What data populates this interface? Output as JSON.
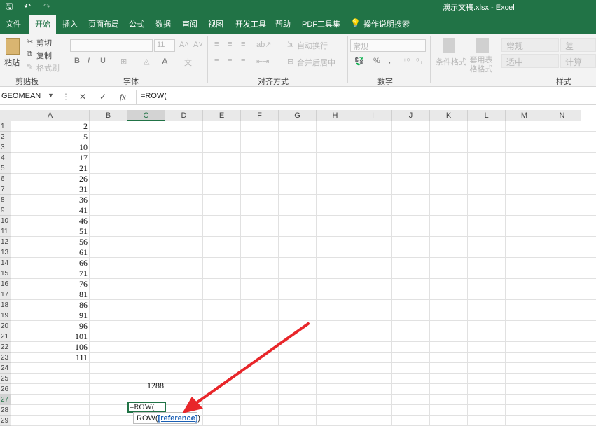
{
  "titlebar": {
    "title": "演示文稿.xlsx - Excel",
    "save_glyph": "🖫",
    "undo_glyph": "↶",
    "redo_glyph": "↷"
  },
  "tabs": [
    "文件",
    "开始",
    "插入",
    "页面布局",
    "公式",
    "数据",
    "审阅",
    "视图",
    "开发工具",
    "帮助",
    "PDF工具集",
    "操作说明搜索"
  ],
  "ribbon": {
    "clipboard": {
      "paste": "粘贴",
      "cut": "剪切",
      "copy": "复制",
      "format_painter": "格式刷",
      "label": "剪贴板"
    },
    "font": {
      "size": "11",
      "bold": "B",
      "italic": "I",
      "underline": "U",
      "label": "字体"
    },
    "alignment": {
      "wrap": "自动换行",
      "merge": "合并后居中",
      "label": "对齐方式"
    },
    "number": {
      "format": "常规",
      "percent": "%",
      "comma": ",",
      "label": "数字"
    },
    "styles": {
      "conditional": "条件格式",
      "table": "套用表格格式",
      "normal": "常规",
      "bad": "差",
      "neutral": "适中",
      "calc": "计算",
      "label": "样式"
    }
  },
  "formula_bar": {
    "name_box": "GEOMEAN",
    "cancel": "✕",
    "enter": "✓",
    "fx": "fx",
    "content": "=ROW("
  },
  "columns": [
    "A",
    "B",
    "C",
    "D",
    "E",
    "F",
    "G",
    "H",
    "I",
    "J",
    "K",
    "L",
    "M",
    "N"
  ],
  "rows": [
    "1",
    "2",
    "3",
    "4",
    "5",
    "6",
    "7",
    "8",
    "9",
    "10",
    "11",
    "12",
    "13",
    "14",
    "15",
    "16",
    "17",
    "18",
    "19",
    "20",
    "21",
    "22",
    "23",
    "24",
    "25",
    "26",
    "27",
    "28",
    "29"
  ],
  "column_a_values": [
    "2",
    "5",
    "10",
    "17",
    "21",
    "26",
    "31",
    "36",
    "41",
    "46",
    "51",
    "56",
    "61",
    "66",
    "71",
    "76",
    "81",
    "86",
    "91",
    "96",
    "101",
    "106",
    "111"
  ],
  "c25_value": "1288",
  "active_cell_text": "=ROW(",
  "tooltip": {
    "func": "ROW(",
    "arg": "[reference]",
    "close": ")"
  }
}
